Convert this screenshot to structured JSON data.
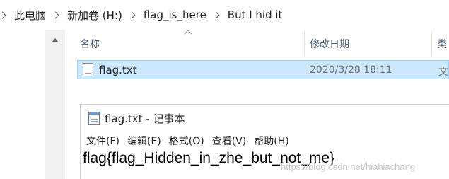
{
  "breadcrumb": [
    "此电脑",
    "新加卷 (H:)",
    "flag_is_here",
    "But I hid it"
  ],
  "columns": {
    "name": "名称",
    "modified": "修改日期",
    "type": "类"
  },
  "file": {
    "name": "flag.txt",
    "modified": "2020/3/28 18:11",
    "type": "文"
  },
  "notepad": {
    "title": "flag.txt - 记事本",
    "menus": [
      "文件(F)",
      "编辑(E)",
      "格式(O)",
      "查看(V)",
      "帮助(H)"
    ],
    "content": "flag{flag_Hidden_in_zhe_but_not_me}"
  },
  "watermark": "https://blog.csdn.net/hiahiachang",
  "colors": {
    "selection": "#cce8ff",
    "selection_border": "#99d1ff",
    "header_text": "#4c607a"
  }
}
